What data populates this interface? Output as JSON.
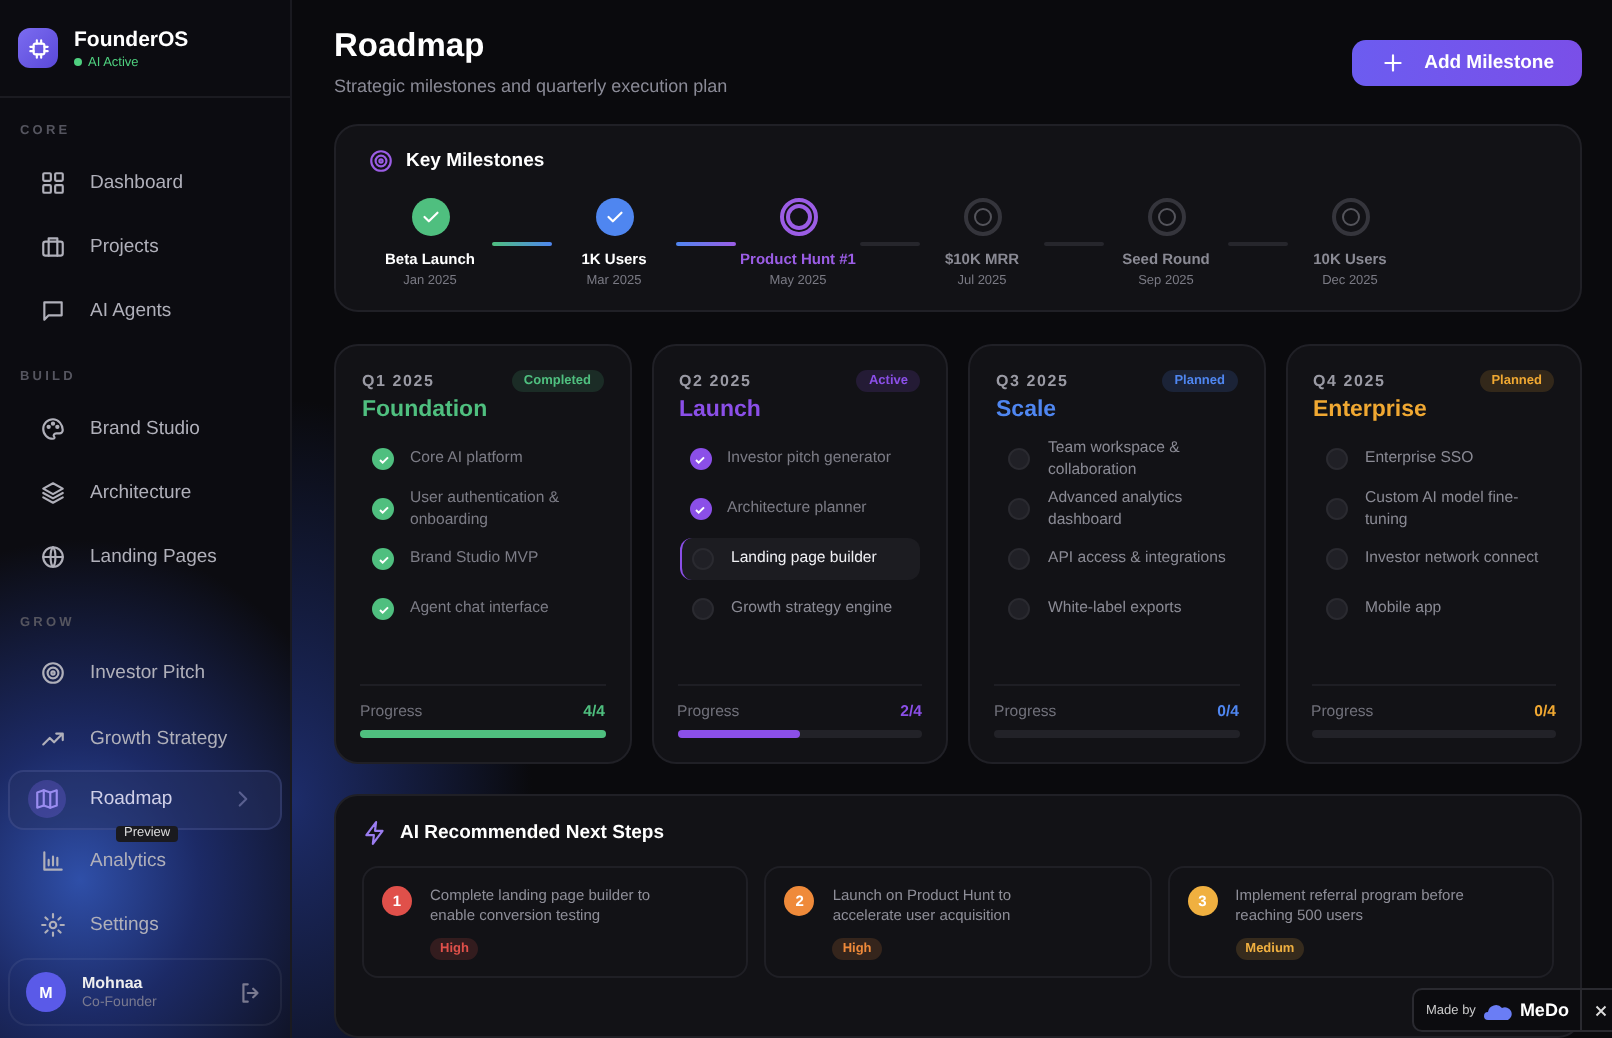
{
  "sidebar": {
    "brand": {
      "name": "FounderOS",
      "status": "AI Active"
    },
    "sections": [
      {
        "label": "CORE",
        "items": [
          {
            "label": "Dashboard",
            "selected": false
          },
          {
            "label": "Projects",
            "selected": false
          },
          {
            "label": "AI Agents",
            "selected": false
          }
        ]
      },
      {
        "label": "BUILD",
        "items": [
          {
            "label": "Brand Studio",
            "selected": false
          },
          {
            "label": "Architecture",
            "selected": false
          },
          {
            "label": "Landing Pages",
            "selected": false
          }
        ]
      },
      {
        "label": "GROW",
        "items": [
          {
            "label": "Investor Pitch",
            "selected": false
          },
          {
            "label": "Growth Strategy",
            "selected": false
          },
          {
            "label": "Roadmap",
            "selected": true
          },
          {
            "label": "Analytics",
            "selected": false
          },
          {
            "label": "Settings",
            "selected": false
          }
        ]
      }
    ],
    "tooltip": "Preview",
    "user": {
      "initial": "M",
      "name": "Mohnaa",
      "role": "Co-Founder"
    }
  },
  "header": {
    "title": "Roadmap",
    "subtitle": "Strategic milestones and quarterly execution plan",
    "action": "Add Milestone"
  },
  "milestones": {
    "title": "Key Milestones",
    "items": [
      {
        "name": "Beta Launch",
        "date": "Jan 2025",
        "done": true,
        "current": false,
        "color": "#4fbf7f"
      },
      {
        "name": "1K Users",
        "date": "Mar 2025",
        "done": true,
        "current": false,
        "color": "#4f86f0"
      },
      {
        "name": "Product Hunt #1",
        "date": "May 2025",
        "done": false,
        "current": true,
        "color": "#9b5de5"
      },
      {
        "name": "$10K MRR",
        "date": "Jul 2025",
        "done": false,
        "current": false
      },
      {
        "name": "Seed Round",
        "date": "Sep 2025",
        "done": false,
        "current": false
      },
      {
        "name": "10K Users",
        "date": "Dec 2025",
        "done": false,
        "current": false
      }
    ]
  },
  "quarters": [
    {
      "period": "Q1 2025",
      "name": "Foundation",
      "badge": "Completed",
      "color": "#4fbf7f",
      "progress_label": "Progress",
      "progress": "4/4",
      "level": 1,
      "tasks": [
        {
          "label": "Core AI platform",
          "done": true,
          "current": false
        },
        {
          "label": "User authentication & onboarding",
          "done": true,
          "current": false
        },
        {
          "label": "Brand Studio MVP",
          "done": true,
          "current": false
        },
        {
          "label": "Agent chat interface",
          "done": true,
          "current": false
        }
      ]
    },
    {
      "period": "Q2 2025",
      "name": "Launch",
      "badge": "Active",
      "color": "#8b4fe8",
      "progress_label": "Progress",
      "progress": "2/4",
      "level": 0.5,
      "tasks": [
        {
          "label": "Investor pitch generator",
          "done": true,
          "current": false
        },
        {
          "label": "Architecture planner",
          "done": true,
          "current": false
        },
        {
          "label": "Landing page builder",
          "done": false,
          "current": true
        },
        {
          "label": "Growth strategy engine",
          "done": false,
          "current": false
        }
      ]
    },
    {
      "period": "Q3 2025",
      "name": "Scale",
      "badge": "Planned",
      "color": "#4f86f0",
      "progress_label": "Progress",
      "progress": "0/4",
      "level": 0,
      "tasks": [
        {
          "label": "Team workspace & collaboration",
          "done": false,
          "current": false
        },
        {
          "label": "Advanced analytics dashboard",
          "done": false,
          "current": false
        },
        {
          "label": "API access & integrations",
          "done": false,
          "current": false
        },
        {
          "label": "White-label exports",
          "done": false,
          "current": false
        }
      ]
    },
    {
      "period": "Q4 2025",
      "name": "Enterprise",
      "badge": "Planned",
      "color": "#f0a832",
      "progress_label": "Progress",
      "progress": "0/4",
      "level": 0,
      "tasks": [
        {
          "label": "Enterprise SSO",
          "done": false,
          "current": false
        },
        {
          "label": "Custom AI model fine-tuning",
          "done": false,
          "current": false
        },
        {
          "label": "Investor network connect",
          "done": false,
          "current": false
        },
        {
          "label": "Mobile app",
          "done": false,
          "current": false
        }
      ]
    }
  ],
  "next_steps": {
    "title": "AI Recommended Next Steps",
    "items": [
      {
        "number": "1",
        "text": "Complete landing page builder to enable conversion testing",
        "priority": "High",
        "color": "#e0504a"
      },
      {
        "number": "2",
        "text": "Launch on Product Hunt to accelerate user acquisition",
        "priority": "High",
        "color": "#ef8a3a"
      },
      {
        "number": "3",
        "text": "Implement referral program before reaching 500 users",
        "priority": "Medium",
        "color": "#f0b040"
      }
    ]
  },
  "made_by": {
    "text": "Made by",
    "brand": "MeDo"
  }
}
